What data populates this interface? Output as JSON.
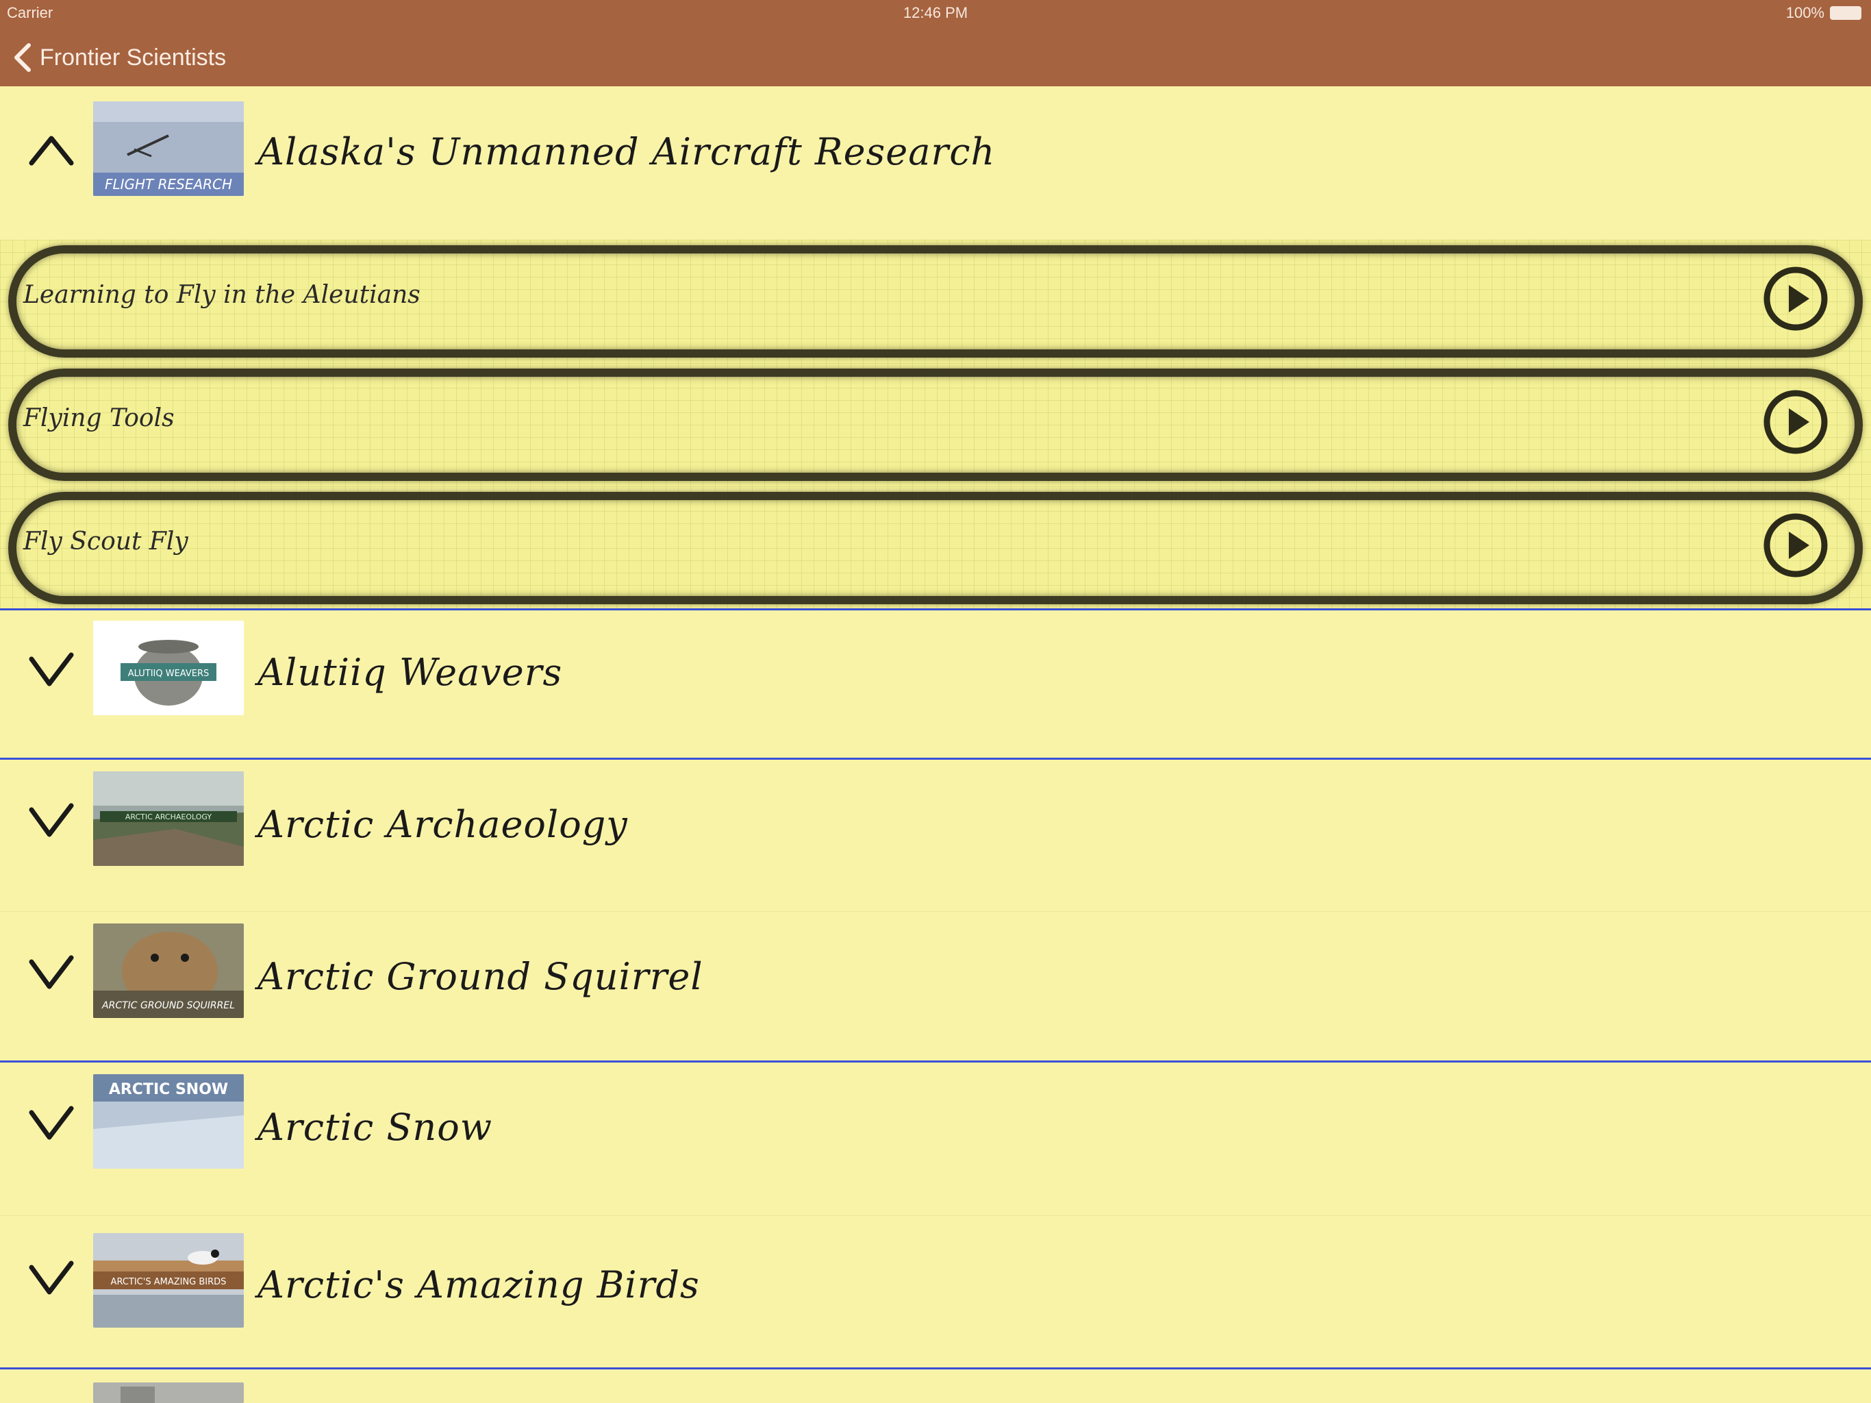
{
  "status_bar": {
    "carrier": "Carrier",
    "time": "12:46 PM",
    "battery": "100%"
  },
  "nav": {
    "back_label": "Frontier Scientists"
  },
  "sections": [
    {
      "title": "Alaska's Unmanned Aircraft Research",
      "expanded": true,
      "thumb_text": "FLIGHT RESEARCH",
      "episodes": [
        {
          "label": "Learning to Fly in the Aleutians"
        },
        {
          "label": "Flying Tools"
        },
        {
          "label": "Fly Scout Fly"
        }
      ]
    },
    {
      "title": "Alutiiq Weavers",
      "expanded": false,
      "thumb_text": "ALUTIIQ WEAVERS"
    },
    {
      "title": "Arctic Archaeology",
      "expanded": false,
      "thumb_text": "ARCTIC ARCHAEOLOGY"
    },
    {
      "title": "Arctic Ground Squirrel",
      "expanded": false,
      "thumb_text": "ARCTIC GROUND SQUIRREL"
    },
    {
      "title": "Arctic Snow",
      "expanded": false,
      "thumb_text": "ARCTIC SNOW"
    },
    {
      "title": "Arctic's Amazing Birds",
      "expanded": false,
      "thumb_text": "ARCTIC'S AMAZING BIRDS"
    }
  ],
  "colors": {
    "nav_bg": "#a66340",
    "page_bg": "#f9f3a8",
    "divider": "#3b4fd8",
    "frame": "#3c3a22"
  }
}
